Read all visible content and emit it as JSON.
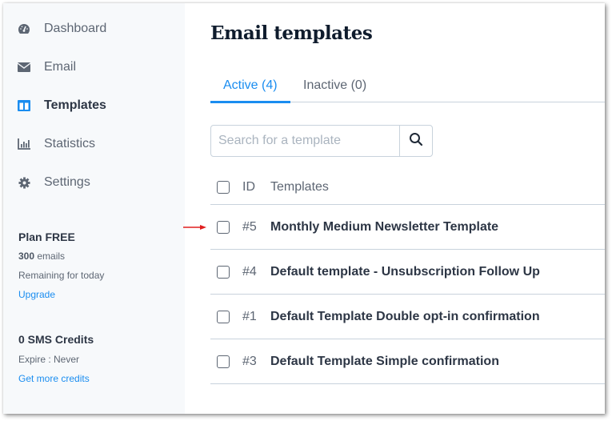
{
  "sidebar": {
    "items": [
      {
        "label": "Dashboard",
        "icon": "dashboard-icon",
        "active": false
      },
      {
        "label": "Email",
        "icon": "envelope-icon",
        "active": false
      },
      {
        "label": "Templates",
        "icon": "templates-icon",
        "active": true
      },
      {
        "label": "Statistics",
        "icon": "bar-chart-icon",
        "active": false
      },
      {
        "label": "Settings",
        "icon": "gear-icon",
        "active": false
      }
    ],
    "plan": {
      "title": "Plan FREE",
      "emails_count": "300",
      "emails_label": " emails",
      "remaining": "Remaining for today",
      "upgrade": "Upgrade"
    },
    "sms": {
      "title": "0 SMS Credits",
      "expire": "Expire : Never",
      "get_more": "Get more credits"
    }
  },
  "main": {
    "title": "Email templates",
    "tabs": [
      {
        "label": "Active (4)",
        "active": true
      },
      {
        "label": "Inactive (0)",
        "active": false
      }
    ],
    "search": {
      "placeholder": "Search for a template",
      "value": ""
    },
    "table": {
      "headers": {
        "id": "ID",
        "name": "Templates"
      },
      "rows": [
        {
          "id": "#5",
          "name": "Monthly Medium Newsletter Template",
          "checked": false
        },
        {
          "id": "#4",
          "name": "Default template - Unsubscription Follow Up",
          "checked": false
        },
        {
          "id": "#1",
          "name": "Default Template Double opt-in confirmation",
          "checked": false
        },
        {
          "id": "#3",
          "name": "Default Template Simple confirmation",
          "checked": false
        }
      ]
    }
  },
  "colors": {
    "accent": "#1a8df0",
    "text_dark": "#2d3645",
    "text_muted": "#5d6673",
    "sidebar_bg": "#f7f9fb",
    "annotation": "#e01e1e"
  }
}
